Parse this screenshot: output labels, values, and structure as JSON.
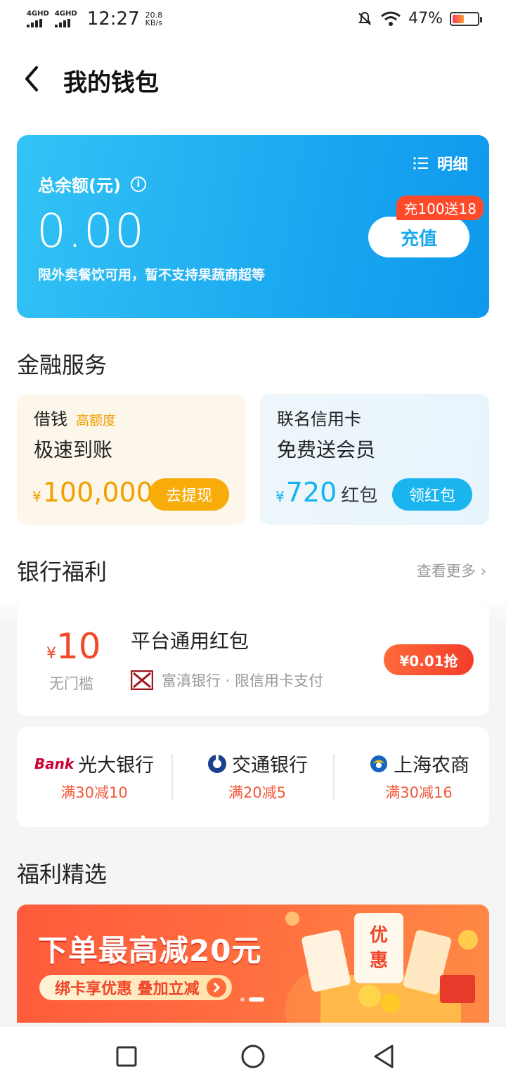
{
  "status_bar": {
    "signal1": "4GHD",
    "signal2": "4GHD",
    "time": "12:27",
    "speed_value": "20.8",
    "speed_unit": "KB/s",
    "battery": "47%"
  },
  "header": {
    "title": "我的钱包"
  },
  "balance": {
    "detail_label": "明细",
    "label": "总余额(元)",
    "amount": "0.00",
    "note": "限外卖餐饮可用，暂不支持果蔬商超等",
    "promo": "充100送18",
    "recharge_label": "充值"
  },
  "finance": {
    "title": "金融服务",
    "loan": {
      "title": "借钱",
      "tag": "高额度",
      "subtitle": "极速到账",
      "currency": "¥",
      "amount": "100,000",
      "button": "去提现",
      "progress_fraction": null
    },
    "credit": {
      "title": "联名信用卡",
      "subtitle": "免费送会员",
      "currency": "¥",
      "amount": "720",
      "unit": "红包",
      "button": "领红包"
    }
  },
  "bank_benefits": {
    "title": "银行福利",
    "more": "查看更多 ›",
    "coupon": {
      "currency": "¥",
      "value": "10",
      "threshold": "无门槛",
      "title": "平台通用红包",
      "bank": "富滇银行 · 限信用卡支付",
      "button": "¥0.01抢"
    },
    "deals": [
      {
        "logo_text": "Bank",
        "name": "光大银行",
        "offer": "满30减10"
      },
      {
        "name": "交通银行",
        "offer": "满20减5"
      },
      {
        "name": "上海农商",
        "offer": "满30减16"
      }
    ]
  },
  "featured": {
    "title": "福利精选",
    "banner_headline": "下单最高减20元",
    "banner_pill": "绑卡享优惠 叠加立减",
    "art_text1": "优",
    "art_text2": "惠"
  },
  "colors": {
    "accent_blue": "#1aa8f0",
    "accent_orange": "#f8ac0a",
    "accent_red": "#f04a2a"
  },
  "icons": [
    "back-icon",
    "list-icon",
    "info-icon",
    "bell-off-icon",
    "wifi-icon",
    "battery-icon",
    "square-nav-icon",
    "circle-nav-icon",
    "triangle-back-nav-icon"
  ]
}
